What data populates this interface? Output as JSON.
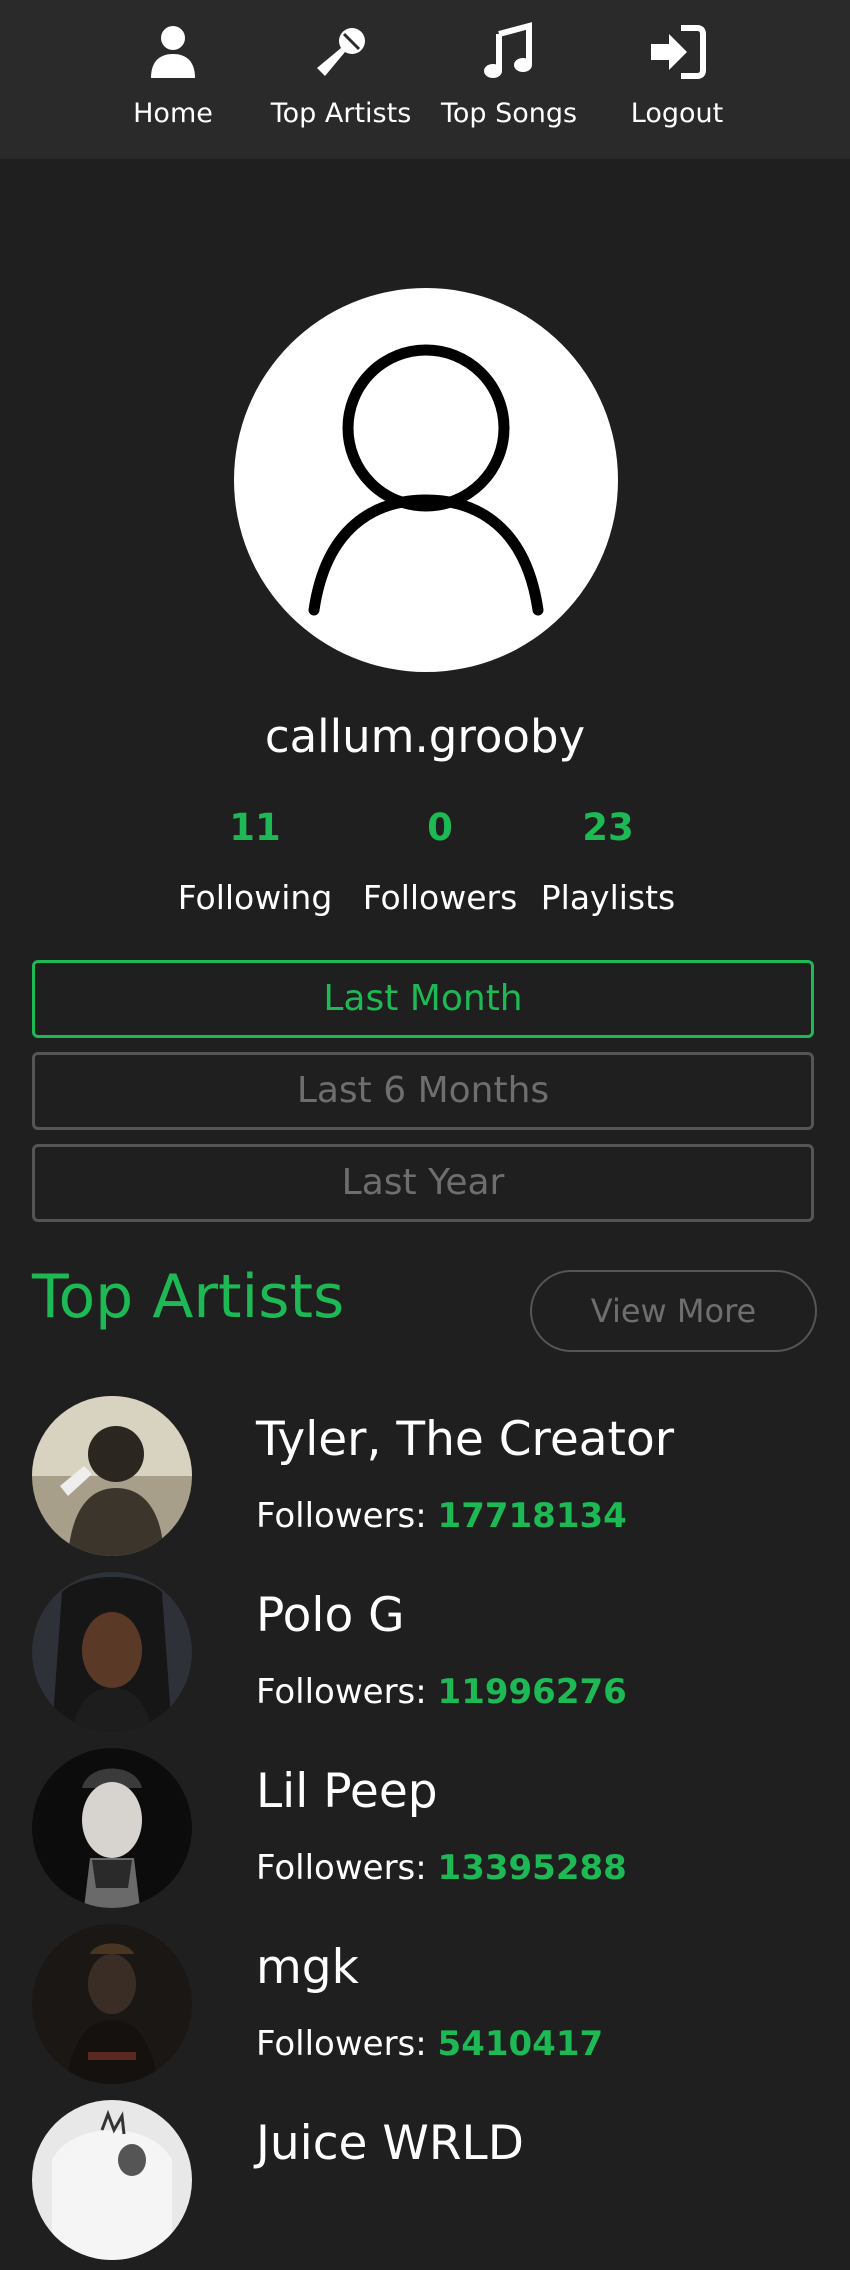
{
  "nav": {
    "items": [
      {
        "label": "Home",
        "icon": "user-icon"
      },
      {
        "label": "Top Artists",
        "icon": "microphone-icon"
      },
      {
        "label": "Top Songs",
        "icon": "music-note-icon"
      },
      {
        "label": "Logout",
        "icon": "sign-in-icon"
      }
    ]
  },
  "profile": {
    "username": "callum.grooby",
    "stats": [
      {
        "value": "11",
        "label": "Following"
      },
      {
        "value": "0",
        "label": "Followers"
      },
      {
        "value": "23",
        "label": "Playlists"
      }
    ]
  },
  "time_range": {
    "options": [
      "Last Month",
      "Last 6 Months",
      "Last Year"
    ],
    "selected": "Last Month"
  },
  "top_artists": {
    "title": "Top Artists",
    "view_more_label": "View More",
    "followers_label": "Followers:",
    "items": [
      {
        "name": "Tyler, The Creator",
        "followers": "17718134"
      },
      {
        "name": "Polo G",
        "followers": "11996276"
      },
      {
        "name": "Lil Peep",
        "followers": "13395288"
      },
      {
        "name": "mgk",
        "followers": "5410417"
      },
      {
        "name": "Juice WRLD",
        "followers": ""
      }
    ]
  },
  "colors": {
    "accent": "#1db954",
    "background": "#1f1f1f",
    "nav_background": "#2a2a2a",
    "muted": "#6e6e6e"
  }
}
